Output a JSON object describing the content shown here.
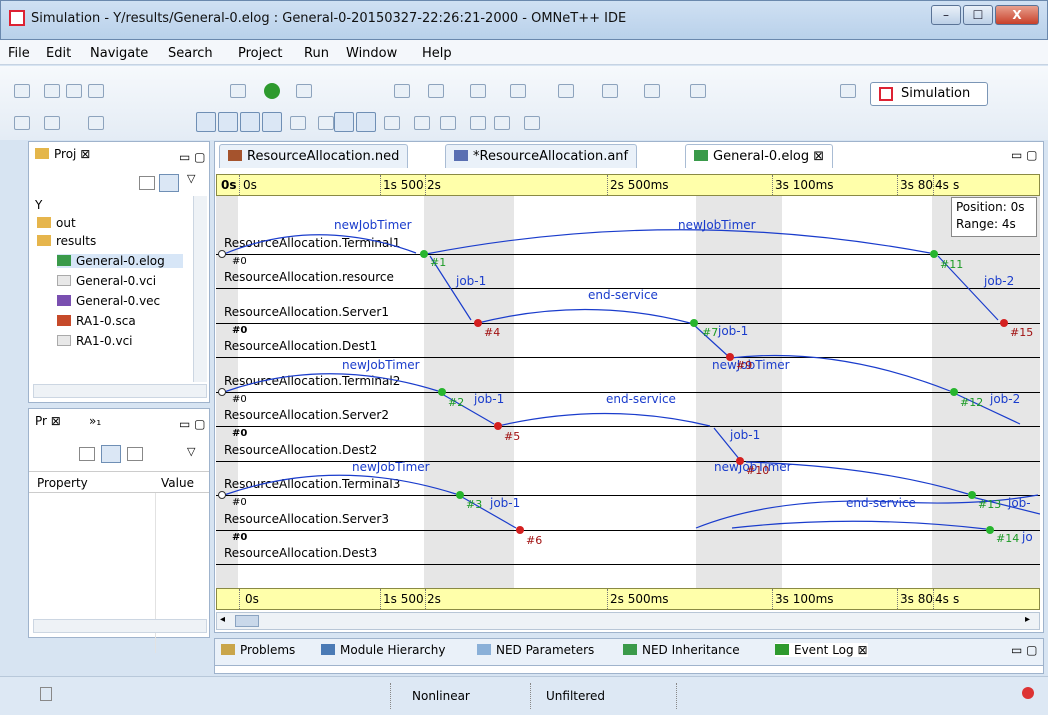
{
  "window": {
    "title": "Simulation - Y/results/General-0.elog : General-0-20150327-22:26:21-2000 - OMNeT++ IDE",
    "minimize": "–",
    "maximize": "☐",
    "close": "X"
  },
  "menu": [
    "File",
    "Edit",
    "Navigate",
    "Search",
    "Project",
    "Run",
    "Window",
    "Help"
  ],
  "toolbar": {
    "perspective_label": "Simulation"
  },
  "project_panel": {
    "tab": "Proj",
    "items": [
      {
        "label": "Y",
        "icon": "project-icon"
      },
      {
        "label": "out",
        "icon": "folder-icon"
      },
      {
        "label": "results",
        "icon": "folder-icon"
      },
      {
        "label": "General-0.elog",
        "icon": "elog-file-icon"
      },
      {
        "label": "General-0.vci",
        "icon": "file-icon"
      },
      {
        "label": "General-0.vec",
        "icon": "vec-file-icon"
      },
      {
        "label": "RA1-0.sca",
        "icon": "sca-file-icon"
      },
      {
        "label": "RA1-0.vci",
        "icon": "file-icon"
      }
    ]
  },
  "properties_panel": {
    "tab": "Pr",
    "tab2": "»₁",
    "col_property": "Property",
    "col_value": "Value"
  },
  "editor_tabs": [
    {
      "label": "ResourceAllocation.ned",
      "icon": "ned-file-icon",
      "active": false
    },
    {
      "label": "*ResourceAllocation.anf",
      "icon": "anf-file-icon",
      "active": false
    },
    {
      "label": "General-0.elog",
      "icon": "elog-file-icon",
      "active": true
    }
  ],
  "timeline": {
    "top_ruler": [
      "0s",
      "0s",
      "1s 500",
      "2s",
      "2s 500ms",
      "3s 100ms",
      "3s 80",
      "4s",
      "s"
    ],
    "bottom_ruler": [
      "0s",
      "1s 500",
      "2s",
      "2s 500ms",
      "3s 100ms",
      "3s 80",
      "4s",
      "s"
    ],
    "position_label": "Position: 0s",
    "range_label": "Range: 4s"
  },
  "modules": [
    "ResourceAllocation.Terminal1",
    "ResourceAllocation.resource",
    "ResourceAllocation.Server1",
    "ResourceAllocation.Dest1",
    "ResourceAllocation.Terminal2",
    "ResourceAllocation.Server2",
    "ResourceAllocation.Dest2",
    "ResourceAllocation.Terminal3",
    "ResourceAllocation.Server3",
    "ResourceAllocation.Dest3"
  ],
  "start_events": [
    "#0",
    "#0",
    "#0",
    "#0",
    "#0",
    "#0"
  ],
  "events": [
    "#1",
    "#11",
    "#4",
    "#7",
    "#15",
    "#2",
    "#12",
    "#5",
    "#3",
    "#13",
    "#6",
    "#14",
    "#10",
    "#9"
  ],
  "messages": [
    "newJobTimer",
    "newJobTimer",
    "job-1",
    "job-2",
    "end-service",
    "job-1",
    "newJobTimer",
    "newJobTimer",
    "job-1",
    "job-2",
    "end-service",
    "job-1",
    "newJobTimer",
    "newJobTimer",
    "job-1",
    "end-service",
    "job-",
    "jo"
  ],
  "bottom_tabs": [
    "Problems",
    "Module Hierarchy",
    "NED Parameters",
    "NED Inheritance",
    "Event Log"
  ],
  "status": {
    "mode": "Nonlinear",
    "filter": "Unfiltered"
  }
}
